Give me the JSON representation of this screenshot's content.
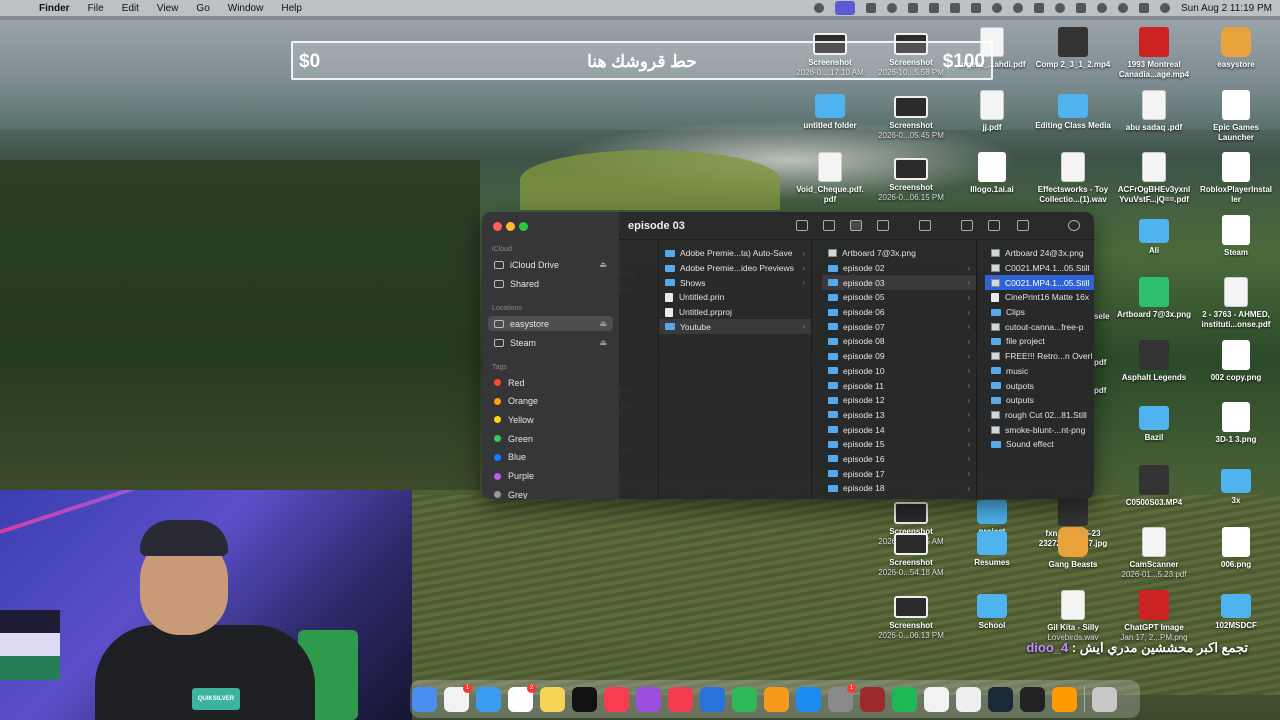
{
  "menubar": {
    "app_name": "Finder",
    "menus": [
      "File",
      "Edit",
      "View",
      "Go",
      "Window",
      "Help"
    ],
    "clock": "Sun Aug 2  11:19 PM"
  },
  "donation_goal": {
    "min": "$0",
    "max": "$100",
    "title": "حط قروشك هنا",
    "progress_fraction": 0
  },
  "desktop_icons": [
    {
      "label": "Screenshot",
      "sub": "2026-0....17.10 AM",
      "kind": "shot"
    },
    {
      "label": "Screenshot",
      "sub": "2026-10...5.58 PM",
      "kind": "shot"
    },
    {
      "label": "urgent_...ahdi.pdf",
      "sub": "",
      "kind": "doc"
    },
    {
      "label": "Comp 2_3_1_2.mp4",
      "sub": "",
      "kind": "dark"
    },
    {
      "label": "1993 Montreal Canadia...age.mp4",
      "sub": "",
      "kind": "red"
    },
    {
      "label": "easystore",
      "sub": "",
      "kind": "app"
    },
    {
      "label": "untitled folder",
      "sub": "",
      "kind": "folder"
    },
    {
      "label": "Screenshot",
      "sub": "2026-0...05.45 PM",
      "kind": "shot"
    },
    {
      "label": "jj.pdf",
      "sub": "",
      "kind": "doc"
    },
    {
      "label": "Editing Class Media",
      "sub": "",
      "kind": "folder"
    },
    {
      "label": "abu sadaq .pdf",
      "sub": "",
      "kind": "doc"
    },
    {
      "label": "Epic Games Launcher",
      "sub": "",
      "kind": "white"
    },
    {
      "label": "Void_Cheque.pdf. pdf",
      "sub": "",
      "kind": "doc"
    },
    {
      "label": "Screenshot",
      "sub": "2026-0...06.15 PM",
      "kind": "shot"
    },
    {
      "label": "Illogo.1ai.ai",
      "sub": "",
      "kind": "white"
    },
    {
      "label": "Effectsworks - Toy Collectio...(1).wav",
      "sub": "",
      "kind": "doc"
    },
    {
      "label": "ACFrOgBHEv3yxnl YvuVstF...jQ==.pdf",
      "sub": "",
      "kind": "doc"
    },
    {
      "label": "RobloxPlayerInstal ler",
      "sub": "",
      "kind": "white"
    },
    {
      "label": "Ali",
      "sub": "",
      "kind": "folder"
    },
    {
      "label": "Steam",
      "sub": "",
      "kind": "white"
    },
    {
      "label": "Artboard 7@3x.png",
      "sub": "",
      "kind": "green"
    },
    {
      "label": "2 - 3763 - AHMED, instituti...onse.pdf",
      "sub": "",
      "kind": "doc"
    },
    {
      "label": "Asphalt Legends",
      "sub": "",
      "kind": "dark"
    },
    {
      "label": "002 copy.png",
      "sub": "",
      "kind": "white"
    },
    {
      "label": "Bazil",
      "sub": "",
      "kind": "folder"
    },
    {
      "label": "3D-1 3.png",
      "sub": "",
      "kind": "white"
    },
    {
      "label": "Screenshot",
      "sub": "2026-07...1.35 AM",
      "kind": "shot"
    },
    {
      "label": "project",
      "sub": "",
      "kind": "folder"
    },
    {
      "label": "fxn 2026-05-23 232724...CFD7.jpg",
      "sub": "",
      "kind": "dark"
    },
    {
      "label": "C0500S03.MP4",
      "sub": "",
      "kind": "dark"
    },
    {
      "label": "3x",
      "sub": "",
      "kind": "folder"
    },
    {
      "label": "Screenshot",
      "sub": "2026-0...54.18 AM",
      "kind": "shot"
    },
    {
      "label": "Resumes",
      "sub": "",
      "kind": "folder"
    },
    {
      "label": "Gang Beasts",
      "sub": "",
      "kind": "app"
    },
    {
      "label": "CamScanner",
      "sub": "2026-01...5.23.pdf",
      "kind": "doc"
    },
    {
      "label": "006.png",
      "sub": "",
      "kind": "white"
    },
    {
      "label": "Screenshot",
      "sub": "2026-0...06.13 PM",
      "kind": "shot"
    },
    {
      "label": "School",
      "sub": "",
      "kind": "folder"
    },
    {
      "label": "Gil Kita - Silly",
      "sub": "Lovebirds.wav",
      "kind": "doc"
    },
    {
      "label": "ChatGPT Image",
      "sub": "Jan 17, 2...PM.png",
      "kind": "red"
    },
    {
      "label": "102MSDCF",
      "sub": "",
      "kind": "folder"
    }
  ],
  "partial_labels": [
    "sele",
    "pdf",
    "pdf",
    "mp3",
    "ave",
    "pdf",
    ".pdf",
    ".jpg"
  ],
  "finder": {
    "title": "episode 03",
    "sidebar": {
      "icloud_header": "iCloud",
      "icloud": [
        "iCloud Drive",
        "Shared"
      ],
      "locations_header": "Locations",
      "locations": [
        "easystore",
        "Steam"
      ],
      "tags_header": "Tags",
      "tags": [
        {
          "name": "Red",
          "color": "#ff453a"
        },
        {
          "name": "Orange",
          "color": "#ff9f0a"
        },
        {
          "name": "Yellow",
          "color": "#ffd60a"
        },
        {
          "name": "Green",
          "color": "#30d158"
        },
        {
          "name": "Blue",
          "color": "#0a84ff"
        },
        {
          "name": "Purple",
          "color": "#bf5af2"
        },
        {
          "name": "Grey",
          "color": "#98989d"
        }
      ]
    },
    "col1": [
      {
        "name": "Adobe Premie...ta) Auto-Save",
        "kind": "folder",
        "chev": true
      },
      {
        "name": "Adobe Premie...ideo Previews",
        "kind": "folder",
        "chev": true
      },
      {
        "name": "Shows",
        "kind": "folder",
        "chev": true
      },
      {
        "name": "Untitled.prin",
        "kind": "file",
        "chev": false
      },
      {
        "name": "Untitled.prproj",
        "kind": "file",
        "chev": false
      },
      {
        "name": "Youtube",
        "kind": "folder",
        "chev": true,
        "selected": true
      }
    ],
    "col2": [
      {
        "name": "Artboard 7@3x.png",
        "kind": "img",
        "chev": false
      },
      {
        "name": "episode 02",
        "kind": "folder",
        "chev": true
      },
      {
        "name": "episode 03",
        "kind": "folder",
        "chev": true,
        "selected": true
      },
      {
        "name": "episode 05",
        "kind": "folder",
        "chev": true
      },
      {
        "name": "episode 06",
        "kind": "folder",
        "chev": true
      },
      {
        "name": "episode 07",
        "kind": "folder",
        "chev": true
      },
      {
        "name": "episode 08",
        "kind": "folder",
        "chev": true
      },
      {
        "name": "episode 09",
        "kind": "folder",
        "chev": true
      },
      {
        "name": "episode 10",
        "kind": "folder",
        "chev": true
      },
      {
        "name": "episode 11",
        "kind": "folder",
        "chev": true
      },
      {
        "name": "episode 12",
        "kind": "folder",
        "chev": true
      },
      {
        "name": "episode 13",
        "kind": "folder",
        "chev": true
      },
      {
        "name": "episode 14",
        "kind": "folder",
        "chev": true
      },
      {
        "name": "episode 15",
        "kind": "folder",
        "chev": true
      },
      {
        "name": "episode 16",
        "kind": "folder",
        "chev": true
      },
      {
        "name": "episode 17",
        "kind": "folder",
        "chev": true
      },
      {
        "name": "episode 18",
        "kind": "folder",
        "chev": true
      }
    ],
    "col3": [
      {
        "name": "Artboard 24@3x.png",
        "kind": "img"
      },
      {
        "name": "C0021.MP4.1...05.Still",
        "kind": "img"
      },
      {
        "name": "C0021.MP4.1...05.Still",
        "kind": "img",
        "selected": true
      },
      {
        "name": "CinePrint16 Matte 16x",
        "kind": "file"
      },
      {
        "name": "Clips",
        "kind": "folder"
      },
      {
        "name": "cutout-canna...free-p",
        "kind": "img"
      },
      {
        "name": "file project",
        "kind": "folder"
      },
      {
        "name": "FREE!!! Retro...n Overl",
        "kind": "img"
      },
      {
        "name": "music",
        "kind": "folder"
      },
      {
        "name": "outpots",
        "kind": "folder"
      },
      {
        "name": "outputs",
        "kind": "folder"
      },
      {
        "name": "rough Cut  02...81.Still",
        "kind": "img"
      },
      {
        "name": "smoke-blunt-...nt-png",
        "kind": "img"
      },
      {
        "name": "Sound effect",
        "kind": "folder"
      }
    ]
  },
  "chat": {
    "username": "dioo_4",
    "separator": " : ",
    "message": "تجمع اكبر محششين مدري ايش"
  },
  "webcam": {
    "shirt_logo": "QUIKSILVER"
  },
  "dock": [
    "Finder",
    "Launchpad",
    "Safari",
    "Calendar",
    "Notes",
    "Apple TV",
    "Music",
    "Podcasts",
    "News",
    "Keynote",
    "Numbers",
    "Pages",
    "App Store",
    "System Settings",
    "Dictionary",
    "Spotify",
    "Chrome",
    "Checkers",
    "Steam",
    "Activity",
    "Illustrator",
    "Trash"
  ],
  "dock_badges": {
    "Launchpad": "1",
    "Calendar": "2",
    "System Settings": "1"
  }
}
